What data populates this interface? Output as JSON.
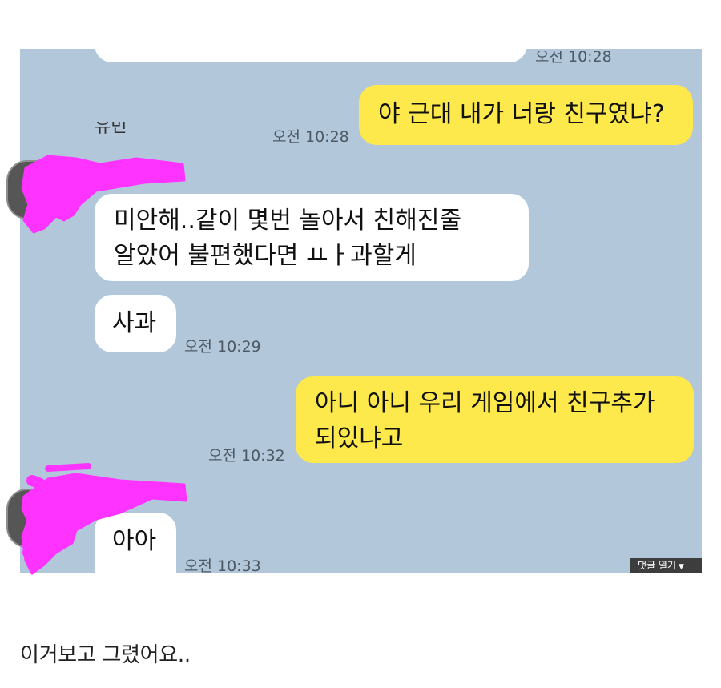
{
  "chat": {
    "top_partial_time": "오전 10:28",
    "messages": [
      {
        "text": "야 근대 내가 너랑 친구였냐?",
        "time": "오전 10:28"
      },
      {
        "line1": "미안해..같이 몇번 놀아서 친해진줄",
        "line2": "알았어 불편했다면 ㅛㅏ과할게"
      },
      {
        "text": "사과",
        "time": "오전 10:29"
      },
      {
        "line1": "아니 아니 우리 게임에서 친구추가",
        "line2": "되있냐고",
        "time": "오전 10:32"
      },
      {
        "text": "아아",
        "time": "오전 10:33"
      }
    ]
  },
  "comment_button": {
    "label": "댓글 열기",
    "icon": "caret-down-icon"
  },
  "caption": "이거보고 그렸어요..",
  "colors": {
    "chat_background": "#b2c7d9",
    "my_bubble": "#fee94d",
    "their_bubble": "#ffffff",
    "redaction": "#ff33ff"
  }
}
